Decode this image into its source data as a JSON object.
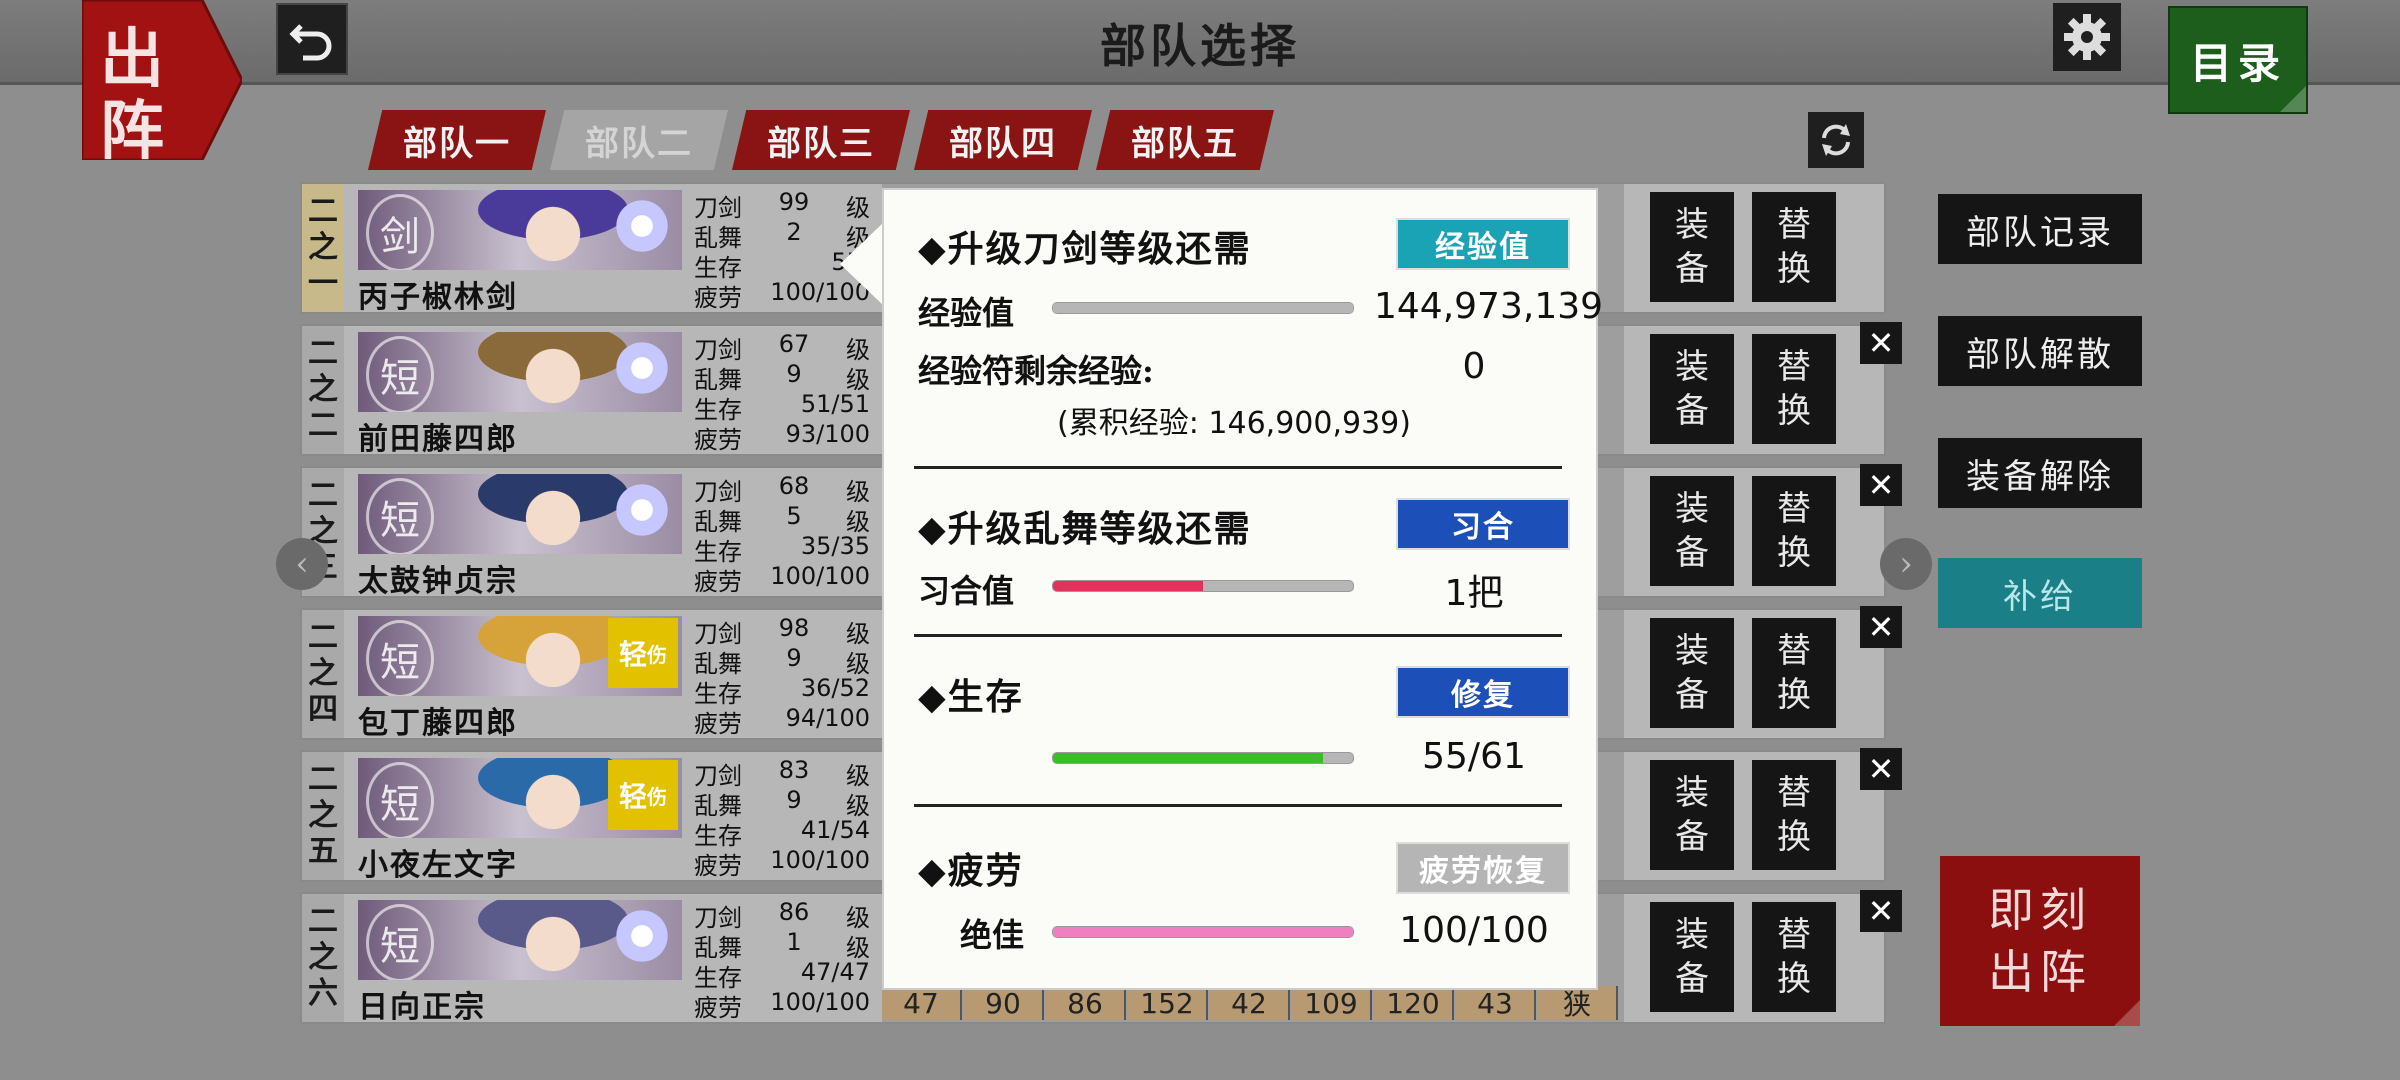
{
  "header": {
    "title": "部队选择",
    "menu_label": "目录",
    "sortie_label_top": "出",
    "sortie_label_bottom": "阵"
  },
  "tabs": [
    {
      "label": "部队一",
      "active": false
    },
    {
      "label": "部队二",
      "active": true
    },
    {
      "label": "部队三",
      "active": false
    },
    {
      "label": "部队四",
      "active": false
    },
    {
      "label": "部队五",
      "active": false
    }
  ],
  "row_labels": {
    "sword": "刀剑",
    "dance": "乱舞",
    "hp": "生存",
    "fatigue": "疲劳",
    "level_unit": "级",
    "equip_1": "装",
    "equip_2": "备",
    "replace_1": "替",
    "replace_2": "换",
    "injured_1": "轻",
    "injured_2": "伤"
  },
  "members": [
    {
      "num": [
        "二",
        "之",
        "一"
      ],
      "name": "丙子椒林剑",
      "type": "剑",
      "sword_lv": "99",
      "dance_lv": "2",
      "hp": "55/",
      "fatigue": "100/100",
      "injured": false
    },
    {
      "num": [
        "二",
        "之",
        "二"
      ],
      "name": "前田藤四郎",
      "type": "短",
      "sword_lv": "67",
      "dance_lv": "9",
      "hp": "51/51",
      "fatigue": "93/100",
      "injured": false
    },
    {
      "num": [
        "二",
        "之",
        "三"
      ],
      "name": "太鼓钟贞宗",
      "type": "短",
      "sword_lv": "68",
      "dance_lv": "5",
      "hp": "35/35",
      "fatigue": "100/100",
      "injured": false
    },
    {
      "num": [
        "二",
        "之",
        "四"
      ],
      "name": "包丁藤四郎",
      "type": "短",
      "sword_lv": "98",
      "dance_lv": "9",
      "hp": "36/52",
      "fatigue": "94/100",
      "injured": true
    },
    {
      "num": [
        "二",
        "之",
        "五"
      ],
      "name": "小夜左文字",
      "type": "短",
      "sword_lv": "83",
      "dance_lv": "9",
      "hp": "41/54",
      "fatigue": "100/100",
      "injured": true
    },
    {
      "num": [
        "二",
        "之",
        "六"
      ],
      "name": "日向正宗",
      "type": "短",
      "sword_lv": "86",
      "dance_lv": "1",
      "hp": "47/47",
      "fatigue": "100/100",
      "injured": false
    }
  ],
  "last_row_cells": [
    "47",
    "90",
    "86",
    "152",
    "42",
    "109",
    "120",
    "43",
    "狭"
  ],
  "side_buttons": {
    "record": "部队记录",
    "disband": "部队解散",
    "unequip": "装备解除",
    "supply": "补给",
    "sortie_now_1": "即刻",
    "sortie_now_2": "出阵"
  },
  "popup": {
    "sword_section": {
      "title": "◆升级刀剑等级还需",
      "tag": "经验值",
      "exp_label": "经验值",
      "exp_value": "144,973,139",
      "exp_fill": 1.0,
      "remain_label": "经验符剩余经验:",
      "remain_value": "0",
      "total": "(累积经验: 146,900,939)"
    },
    "dance_section": {
      "title": "◆升级乱舞等级还需",
      "tag": "习合",
      "label": "习合值",
      "value": "1把",
      "fill": 0.5
    },
    "hp_section": {
      "title": "◆生存",
      "tag": "修复",
      "value": "55/61",
      "fill": 0.9
    },
    "fatigue_section": {
      "title": "◆疲劳",
      "tag": "疲劳恢复",
      "label": "绝佳",
      "value": "100/100",
      "fill": 1.0
    }
  },
  "colors": {
    "tab_red": "#8a1414",
    "exp_tag": "#1aa3b5",
    "blue_tag": "#1d4fb8",
    "gray_tag": "#b5b5b5",
    "dance_bar": "#e0325a",
    "hp_bar": "#3dbb2a",
    "fatigue_bar": "#ee7fc0"
  }
}
